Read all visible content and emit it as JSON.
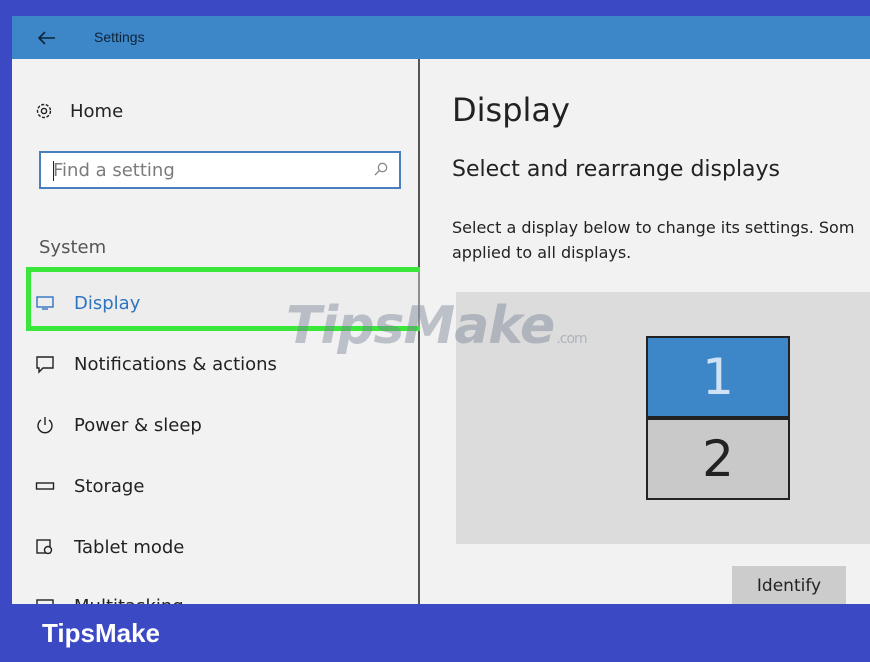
{
  "window": {
    "title": "Settings"
  },
  "sidebar": {
    "home_label": "Home",
    "search": {
      "placeholder": "Find a setting"
    },
    "section_label": "System",
    "items": [
      {
        "label": "Display",
        "icon": "monitor-icon",
        "active": true
      },
      {
        "label": "Notifications & actions",
        "icon": "notification-icon",
        "active": false
      },
      {
        "label": "Power & sleep",
        "icon": "power-icon",
        "active": false
      },
      {
        "label": "Storage",
        "icon": "storage-icon",
        "active": false
      },
      {
        "label": "Tablet mode",
        "icon": "tablet-mode-icon",
        "active": false
      },
      {
        "label": "Multitasking",
        "icon": "multitasking-icon",
        "active": false
      }
    ]
  },
  "main": {
    "page_title": "Display",
    "section_title": "Select and rearrange displays",
    "description_line1": "Select a display below to change its settings. Som",
    "description_line2": "applied to all displays.",
    "displays": [
      "1",
      "2"
    ],
    "identify_label": "Identify"
  },
  "overlay": {
    "watermark_main": "TipsMake",
    "watermark_suffix": ".com",
    "brand": "TipsMake"
  },
  "colors": {
    "titlebar": "#3d86c8",
    "accent": "#2f74c0",
    "highlight": "#39e639",
    "brand_bar": "#3b49c4"
  }
}
